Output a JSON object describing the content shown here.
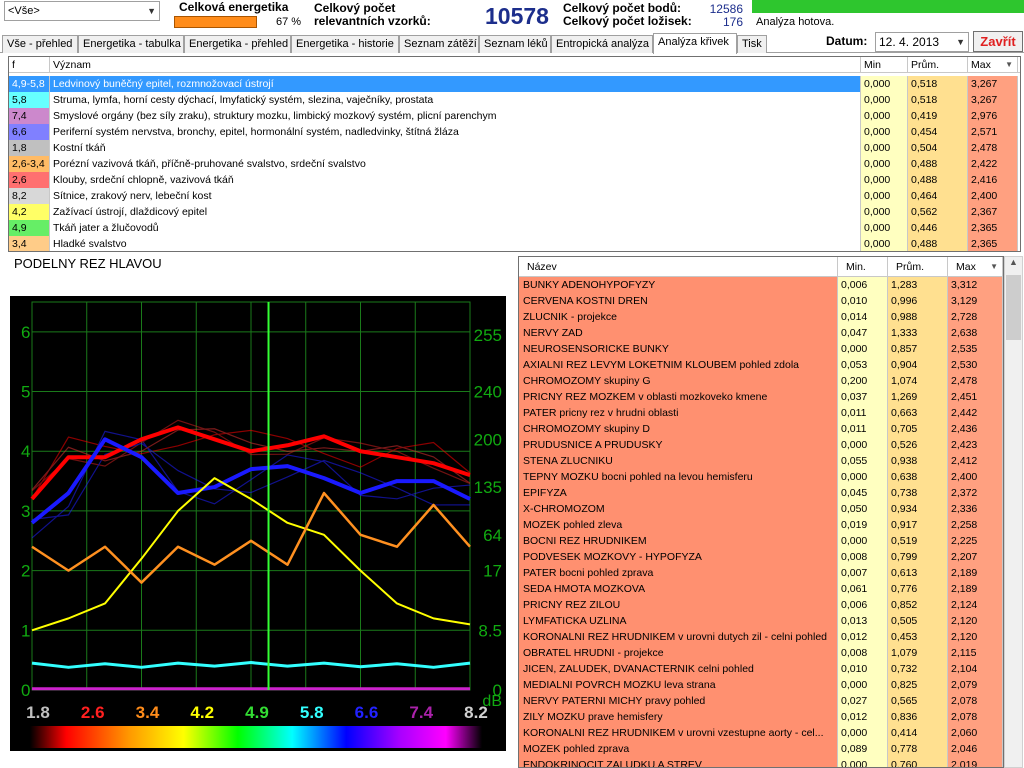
{
  "header": {
    "filter_value": "<Vše>",
    "energy_label": "Celková energetika",
    "energy_percent": "67 %",
    "energy_level": 0.67,
    "samples_label_1": "Celkový počet",
    "samples_label_2": "relevantních vzorků:",
    "samples_value": "10578",
    "points_label": "Celkový počet bodů:",
    "points_value": "12586",
    "beds_label": "Celkový počet ložisek:",
    "beds_value": "176",
    "status": "Analýza hotova.",
    "progress": 1.0
  },
  "tabs": [
    {
      "label": "Vše - přehled"
    },
    {
      "label": "Energetika - tabulka"
    },
    {
      "label": "Energetika - přehled"
    },
    {
      "label": "Energetika - historie"
    },
    {
      "label": "Seznam zátěží"
    },
    {
      "label": "Seznam léků"
    },
    {
      "label": "Entropická analýza"
    },
    {
      "label": "Analýza křivek"
    },
    {
      "label": "Tisk"
    }
  ],
  "active_tab": 7,
  "datum": {
    "label": "Datum:",
    "value": "12. 4. 2013"
  },
  "close_label": "Zavřít",
  "top_table": {
    "headers": {
      "f": "f",
      "meaning": "Význam",
      "min": "Min",
      "avg": "Prům.",
      "max": "Max"
    },
    "rows": [
      {
        "f": "4,9-5,8",
        "color": "#3399ff",
        "meaning": "Ledvinový buněčný epitel, rozmnožovací ústrojí",
        "min": "0,000",
        "avg": "0,518",
        "max": "3,267",
        "selected": true
      },
      {
        "f": "5,8",
        "color": "#66ffff",
        "meaning": "Struma, lymfa, horní cesty dýchací, lmyfatický systém, slezina, vaječníky, prostata",
        "min": "0,000",
        "avg": "0,518",
        "max": "3,267"
      },
      {
        "f": "7,4",
        "color": "#cc88cc",
        "meaning": "Smyslové orgány (bez síly zraku), struktury mozku, limbický mozkový systém, plicní parenchym",
        "min": "0,000",
        "avg": "0,419",
        "max": "2,976"
      },
      {
        "f": "6,6",
        "color": "#8080ff",
        "meaning": "Periferní systém nervstva, bronchy, epitel, hormonální systém, nadledvinky, štítná žláza",
        "min": "0,000",
        "avg": "0,454",
        "max": "2,571"
      },
      {
        "f": "1,8",
        "color": "#c0c0c0",
        "meaning": "Kostní tkáň",
        "min": "0,000",
        "avg": "0,504",
        "max": "2,478"
      },
      {
        "f": "2,6-3,4",
        "color": "#ffbb66",
        "meaning": "Porézní vazivová tkáň, příčně-pruhované svalstvo, srdeční svalstvo",
        "min": "0,000",
        "avg": "0,488",
        "max": "2,422"
      },
      {
        "f": "2,6",
        "color": "#ff7070",
        "meaning": "Klouby, srdeční chlopně, vazivová tkáň",
        "min": "0,000",
        "avg": "0,488",
        "max": "2,416"
      },
      {
        "f": "8,2",
        "color": "#d8d8d8",
        "meaning": "Sítnice, zrakový nerv, lebeční kost",
        "min": "0,000",
        "avg": "0,464",
        "max": "2,400"
      },
      {
        "f": "4,2",
        "color": "#ffff66",
        "meaning": "Zažívací ústrojí, dlaždicový epitel",
        "min": "0,000",
        "avg": "0,562",
        "max": "2,367"
      },
      {
        "f": "4,9",
        "color": "#66ee66",
        "meaning": "Tkáň jater a žlučovodů",
        "min": "0,000",
        "avg": "0,446",
        "max": "2,365"
      },
      {
        "f": "3,4",
        "color": "#ffcc88",
        "meaning": "Hladké svalstvo",
        "min": "0,000",
        "avg": "0,488",
        "max": "2,365"
      }
    ]
  },
  "chart": {
    "title": "PODELNY REZ HLAVOU",
    "left_ticks": [
      "0",
      "1",
      "2",
      "3",
      "4",
      "5",
      "6"
    ],
    "right_ticks": [
      "0",
      "8.5",
      "17",
      "64",
      "135",
      "200",
      "240",
      "255"
    ],
    "right_unit": "dB",
    "freq_labels": [
      {
        "t": "1.8",
        "c": "#c0c0c0"
      },
      {
        "t": "2.6",
        "c": "#ff2020"
      },
      {
        "t": "3.4",
        "c": "#ff8c1a"
      },
      {
        "t": "4.2",
        "c": "#ffff00"
      },
      {
        "t": "4.9",
        "c": "#33dd33"
      },
      {
        "t": "5.8",
        "c": "#33ffff"
      },
      {
        "t": "6.6",
        "c": "#2222ff"
      },
      {
        "t": "7.4",
        "c": "#aa22aa"
      },
      {
        "t": "8.2",
        "c": "#d0d0d0"
      }
    ]
  },
  "chart_data": {
    "type": "line",
    "title": "PODELNY REZ HLAVOU",
    "ylim": [
      0,
      6.5
    ],
    "marker_x": 0.54,
    "series": [
      {
        "color": "#ff0000",
        "values": [
          3.2,
          3.9,
          3.9,
          4.2,
          4.4,
          4.2,
          4.0,
          4.1,
          4.25,
          4.0,
          3.9,
          3.8,
          3.6
        ]
      },
      {
        "color": "#1a1aff",
        "values": [
          2.8,
          3.3,
          4.2,
          3.9,
          3.3,
          3.4,
          3.7,
          3.75,
          3.55,
          3.3,
          3.5,
          3.5,
          3.2
        ]
      },
      {
        "color": "#ffff00",
        "values": [
          1.0,
          1.2,
          1.45,
          2.2,
          3.0,
          3.55,
          3.2,
          2.8,
          2.6,
          2.0,
          1.45,
          1.2,
          1.1
        ]
      },
      {
        "color": "#ff9020",
        "values": [
          2.4,
          2.0,
          2.4,
          1.8,
          2.4,
          2.1,
          2.5,
          2.1,
          3.3,
          2.6,
          2.4,
          3.1,
          2.4
        ]
      },
      {
        "color": "#33ffff",
        "values": [
          0.45,
          0.38,
          0.44,
          0.38,
          0.45,
          0.4,
          0.46,
          0.4,
          0.45,
          0.39,
          0.44,
          0.38,
          0.45
        ]
      },
      {
        "color": "#cc22cc",
        "values": [
          0.02,
          0.02,
          0.02,
          0.02,
          0.02,
          0.02,
          0.02,
          0.02,
          0.02,
          0.02,
          0.02,
          0.02,
          0.02
        ]
      }
    ]
  },
  "bottom_table": {
    "headers": {
      "name": "Název",
      "min": "Min.",
      "avg": "Prům.",
      "max": "Max"
    },
    "rows": [
      {
        "name": "BUNKY ADENOHYPOFYZY",
        "min": "0,006",
        "avg": "1,283",
        "max": "3,312"
      },
      {
        "name": "CERVENA KOSTNI DREN",
        "min": "0,010",
        "avg": "0,996",
        "max": "3,129"
      },
      {
        "name": "ZLUCNIK - projekce",
        "min": "0,014",
        "avg": "0,988",
        "max": "2,728"
      },
      {
        "name": "NERVY ZAD",
        "min": "0,047",
        "avg": "1,333",
        "max": "2,638"
      },
      {
        "name": "NEUROSENSORICKE BUNKY",
        "min": "0,000",
        "avg": "0,857",
        "max": "2,535"
      },
      {
        "name": "AXIALNI REZ LEVYM LOKETNIM KLOUBEM pohled zdola",
        "min": "0,053",
        "avg": "0,904",
        "max": "2,530"
      },
      {
        "name": "CHROMOZOMY skupiny G",
        "min": "0,200",
        "avg": "1,074",
        "max": "2,478"
      },
      {
        "name": "PRICNY REZ MOZKEM v oblasti mozkoveko kmene",
        "min": "0,037",
        "avg": "1,269",
        "max": "2,451"
      },
      {
        "name": "PATER pricny rez v hrudni oblasti",
        "min": "0,011",
        "avg": "0,663",
        "max": "2,442"
      },
      {
        "name": "CHROMOZOMY skupiny D",
        "min": "0,011",
        "avg": "0,705",
        "max": "2,436"
      },
      {
        "name": "PRUDUSNICE A PRUDUSKY",
        "min": "0,000",
        "avg": "0,526",
        "max": "2,423"
      },
      {
        "name": "STENA ZLUCNIKU",
        "min": "0,055",
        "avg": "0,938",
        "max": "2,412"
      },
      {
        "name": "TEPNY MOZKU bocni pohled na levou hemisferu",
        "min": "0,000",
        "avg": "0,638",
        "max": "2,400"
      },
      {
        "name": "EPIFYZA",
        "min": "0,045",
        "avg": "0,738",
        "max": "2,372"
      },
      {
        "name": "X-CHROMOZOM",
        "min": "0,050",
        "avg": "0,934",
        "max": "2,336"
      },
      {
        "name": "MOZEK pohled zleva",
        "min": "0,019",
        "avg": "0,917",
        "max": "2,258"
      },
      {
        "name": "BOCNI REZ HRUDNIKEM",
        "min": "0,000",
        "avg": "0,519",
        "max": "2,225"
      },
      {
        "name": "PODVESEK MOZKOVY - HYPOFYZA",
        "min": "0,008",
        "avg": "0,799",
        "max": "2,207"
      },
      {
        "name": "PATER bocni pohled zprava",
        "min": "0,007",
        "avg": "0,613",
        "max": "2,189"
      },
      {
        "name": "SEDA HMOTA MOZKOVA",
        "min": "0,061",
        "avg": "0,776",
        "max": "2,189"
      },
      {
        "name": "PRICNY REZ ZILOU",
        "min": "0,006",
        "avg": "0,852",
        "max": "2,124"
      },
      {
        "name": "LYMFATICKA UZLINA",
        "min": "0,013",
        "avg": "0,505",
        "max": "2,120"
      },
      {
        "name": "KORONALNI REZ HRUDNIKEM v urovni dutych zil - celni pohled",
        "min": "0,012",
        "avg": "0,453",
        "max": "2,120"
      },
      {
        "name": "OBRATEL HRUDNI - projekce",
        "min": "0,008",
        "avg": "1,079",
        "max": "2,115"
      },
      {
        "name": "JICEN, ZALUDEK, DVANACTERNIK celni pohled",
        "min": "0,010",
        "avg": "0,732",
        "max": "2,104"
      },
      {
        "name": "MEDIALNI POVRCH MOZKU leva strana",
        "min": "0,000",
        "avg": "0,825",
        "max": "2,079"
      },
      {
        "name": "NERVY PATERNI MICHY pravy pohled",
        "min": "0,027",
        "avg": "0,565",
        "max": "2,078"
      },
      {
        "name": "ZILY MOZKU prave hemisfery",
        "min": "0,012",
        "avg": "0,836",
        "max": "2,078"
      },
      {
        "name": "KORONALNI REZ HRUDNIKEM v urovni vzestupne aorty - cel...",
        "min": "0,000",
        "avg": "0,414",
        "max": "2,060"
      },
      {
        "name": "MOZEK pohled zprava",
        "min": "0,089",
        "avg": "0,778",
        "max": "2,046"
      },
      {
        "name": "ENDOKRINOCIT ZALUDKU A STREV",
        "min": "0,000",
        "avg": "0,760",
        "max": "2,019"
      }
    ]
  }
}
